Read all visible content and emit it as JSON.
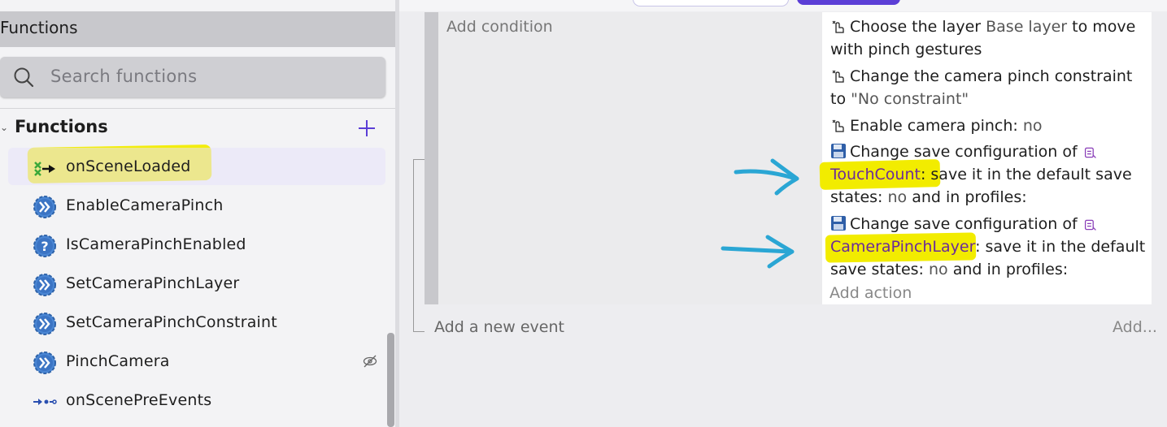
{
  "panel": {
    "title": "Functions",
    "search_placeholder": "Search functions",
    "group_label": "Functions",
    "items": [
      {
        "label": "onSceneLoaded",
        "icon": "scene-loaded-icon",
        "selected": true
      },
      {
        "label": "EnableCameraPinch",
        "icon": "action-function-icon"
      },
      {
        "label": "IsCameraPinchEnabled",
        "icon": "condition-function-icon"
      },
      {
        "label": "SetCameraPinchLayer",
        "icon": "action-function-icon"
      },
      {
        "label": "SetCameraPinchConstraint",
        "icon": "action-function-icon"
      },
      {
        "label": "PinchCamera",
        "icon": "action-function-icon",
        "hidden": true
      },
      {
        "label": "onScenePreEvents",
        "icon": "pre-events-icon"
      }
    ]
  },
  "event": {
    "add_condition": "Add condition",
    "actions": [
      {
        "icon": "pinch-gesture-icon",
        "before": "Choose the layer ",
        "param": "Base layer",
        "after": " to move with pinch gestures"
      },
      {
        "icon": "pinch-gesture-icon",
        "before": "Change the camera pinch constraint to ",
        "param": "\"No constraint\"",
        "after": ""
      },
      {
        "icon": "pinch-gesture-icon",
        "before": "Enable camera pinch: ",
        "param": "no",
        "after": ""
      },
      {
        "icon": "save-icon",
        "before": "Change save configuration of ",
        "variable": "TouchCount",
        "after_var": ": save it in the default save states: ",
        "param2": "no",
        "tail": " and in profiles:"
      },
      {
        "icon": "save-icon",
        "before": "Change save configuration of ",
        "variable": "CameraPinchLayer",
        "after_var": ": save it in the default save states: ",
        "param2": "no",
        "tail": " and in profiles:"
      }
    ],
    "add_action": "Add action",
    "add_new_event": "Add a new event",
    "add_more": "Add..."
  },
  "colors": {
    "accent": "#5b3ed6",
    "highlight": "#f2ec00",
    "annotation_arrow": "#2aa6d4",
    "selected_bg": "#e6e1fa"
  }
}
